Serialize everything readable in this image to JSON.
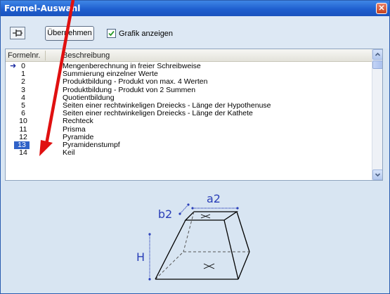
{
  "window": {
    "title": "Formel-Auswahl",
    "close_glyph": "✕"
  },
  "toolbar": {
    "pin_icon": "pin-icon",
    "apply_label": "Übernehmen",
    "show_graphic_label": "Grafik anzeigen",
    "show_graphic_checked": true
  },
  "list": {
    "columns": [
      "Formelnr.",
      "Beschreibung"
    ],
    "rows": [
      {
        "num": "0",
        "desc": "Mengenberechnung in freier Schreibweise",
        "current": true
      },
      {
        "num": "1",
        "desc": "Summierung einzelner Werte"
      },
      {
        "num": "2",
        "desc": "Produktbildung - Produkt von max. 4 Werten"
      },
      {
        "num": "3",
        "desc": "Produktbildung - Produkt von 2 Summen"
      },
      {
        "num": "4",
        "desc": "Quotientbildung"
      },
      {
        "num": "5",
        "desc": "Seiten einer rechtwinkeligen Dreiecks - Länge der Hypothenuse"
      },
      {
        "num": "6",
        "desc": "Seiten einer rechtwinkeligen Dreiecks - Länge der Kathete"
      },
      {
        "num": "10",
        "desc": "Rechteck"
      },
      {
        "num": "11",
        "desc": "Prisma"
      },
      {
        "num": "12",
        "desc": "Pyramide"
      },
      {
        "num": "13",
        "desc": "Pyramidenstumpf",
        "selected": true
      },
      {
        "num": "14",
        "desc": "Keil"
      }
    ]
  },
  "graphic": {
    "label_a2": "a2",
    "label_b2": "b2",
    "label_h": "H"
  },
  "colors": {
    "title_bar": "#1f5fcf",
    "selection": "#2f62c8",
    "annotation_arrow": "#e01010",
    "diagram_blue": "#2a3fb8"
  }
}
